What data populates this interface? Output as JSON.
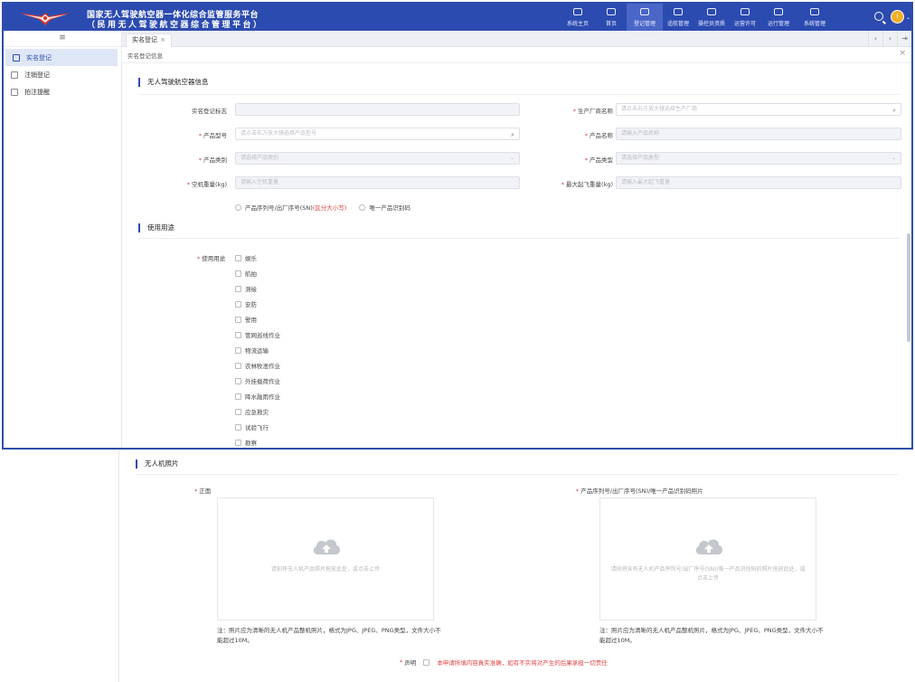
{
  "header": {
    "title_line1": "国家无人驾驶航空器一体化综合监管服务平台",
    "title_line2": "（民用无人驾驶航空器综合管理平台）",
    "nav": [
      {
        "label": "系统主页",
        "active": false
      },
      {
        "label": "首页",
        "active": false
      },
      {
        "label": "登记管理",
        "active": true
      },
      {
        "label": "适航管理",
        "active": false
      },
      {
        "label": "操控员资质",
        "active": false
      },
      {
        "label": "运营许可",
        "active": false
      },
      {
        "label": "运行管理",
        "active": false
      },
      {
        "label": "系统管理",
        "active": false
      }
    ],
    "avatar_letter": "I",
    "accent_color": "#2c4bb0"
  },
  "sidebar": {
    "toggle_icon": "menu-icon",
    "items": [
      {
        "label": "实名登记",
        "active": true
      },
      {
        "label": "注销登记",
        "active": false
      },
      {
        "label": "拍注提醒",
        "active": false
      }
    ]
  },
  "tabs": {
    "active_label": "实名登记",
    "close": "×"
  },
  "subbar": {
    "title": "实名登记信息",
    "close": "×"
  },
  "form": {
    "section1_title": "无人驾驶航空器信息",
    "fields": {
      "reg_id": {
        "label": "实名登记标志",
        "required": false,
        "placeholder": ""
      },
      "manufacturer": {
        "label": "生产厂商名称",
        "required": true,
        "placeholder": "请点击右方放大镜选择生产厂商"
      },
      "model": {
        "label": "产品型号",
        "required": true,
        "placeholder": "请点击右方放大镜选择产品型号"
      },
      "product_name": {
        "label": "产品名称",
        "required": true,
        "placeholder": "请输入产品名称"
      },
      "category": {
        "label": "产品类别",
        "required": true,
        "placeholder": "请选择产品类别"
      },
      "product_type": {
        "label": "产品类型",
        "required": true,
        "placeholder": "请选择产品类型"
      },
      "empty_weight": {
        "label": "空机重量(kg)",
        "required": true,
        "placeholder": "请输入空机重量"
      },
      "max_takeoff": {
        "label": "最大起飞重量(kg)",
        "required": true,
        "placeholder": "请输入最大起飞重量"
      }
    },
    "radio": {
      "option1": "产品序列号/出厂序号(SN)",
      "option1_note": "(区分大小写)",
      "option2": "唯一产品识别码"
    },
    "section2_title": "使用用途",
    "use_label": "使用用途",
    "uses": [
      "娱乐",
      "航拍",
      "测绘",
      "安防",
      "警用",
      "管网巡线作业",
      "物流运输",
      "农林牧渔作业",
      "外挂载荷作业",
      "降水融雨作业",
      "应急救灾",
      "试验飞行",
      "勘察"
    ]
  },
  "photos": {
    "section_title": "无人机照片",
    "front": {
      "label": "正面",
      "hint": "请拍将无人机产品照片拖放此处，或点击上传",
      "note": "注：照片应为清晰的无人机产品整机照片，格式为JPG、JPEG、PNG类型，文件大小不能超过10M。"
    },
    "serial": {
      "label": "产品序列号/出厂序号(SN)/唯一产品识别码照片",
      "hint": "请拍将含有无人机产品序列号/出厂序号(SN)/唯一产品识别码的照片拖放此处，或点击上传",
      "note": "注：照片应为清晰的无人机产品整机照片，格式为JPG、JPEG、PNG类型，文件大小不能超过10M。"
    },
    "declare_label": "声明",
    "declare_text": "本申请所填内容真实准确，如有不实将对产生的后果承担一切责任"
  }
}
